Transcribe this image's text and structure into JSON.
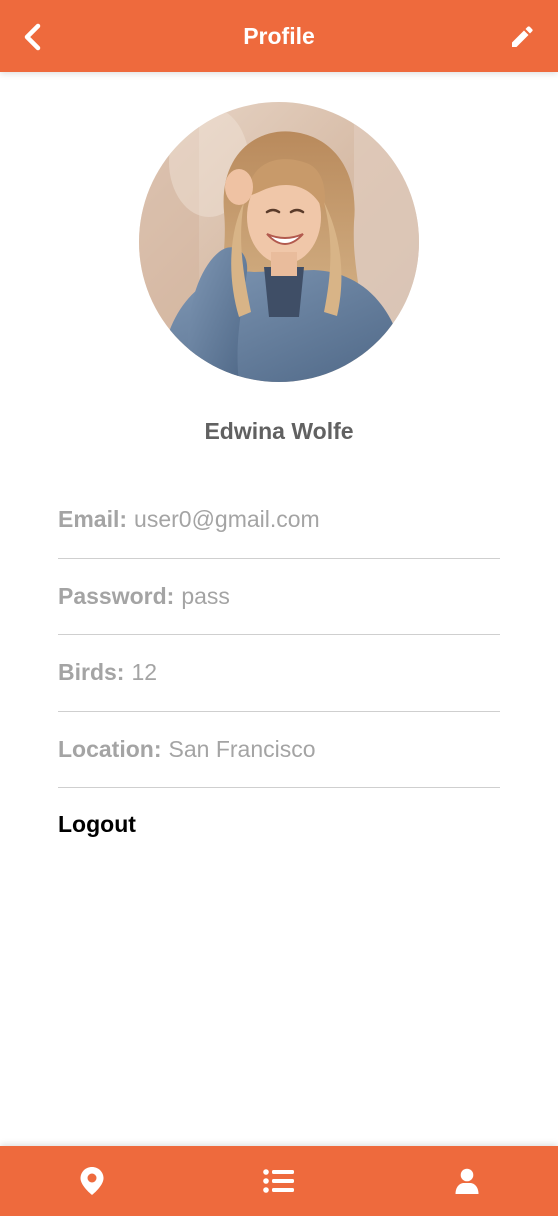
{
  "header": {
    "title": "Profile",
    "back_icon": "chevron-left-icon",
    "edit_icon": "pencil-icon",
    "background_color": "#ee6a3d"
  },
  "profile": {
    "name": "Edwina Wolfe",
    "avatar_icon": "profile-photo"
  },
  "info": [
    {
      "label": "Email:",
      "value": "user0@gmail.com"
    },
    {
      "label": "Password:",
      "value": "pass"
    },
    {
      "label": "Birds:",
      "value": "12"
    },
    {
      "label": "Location:",
      "value": "San Francisco"
    }
  ],
  "logout_label": "Logout",
  "bottom_nav": {
    "items": [
      {
        "icon": "map-pin-icon"
      },
      {
        "icon": "list-icon"
      },
      {
        "icon": "user-icon"
      }
    ],
    "background_color": "#ee6a3d"
  }
}
